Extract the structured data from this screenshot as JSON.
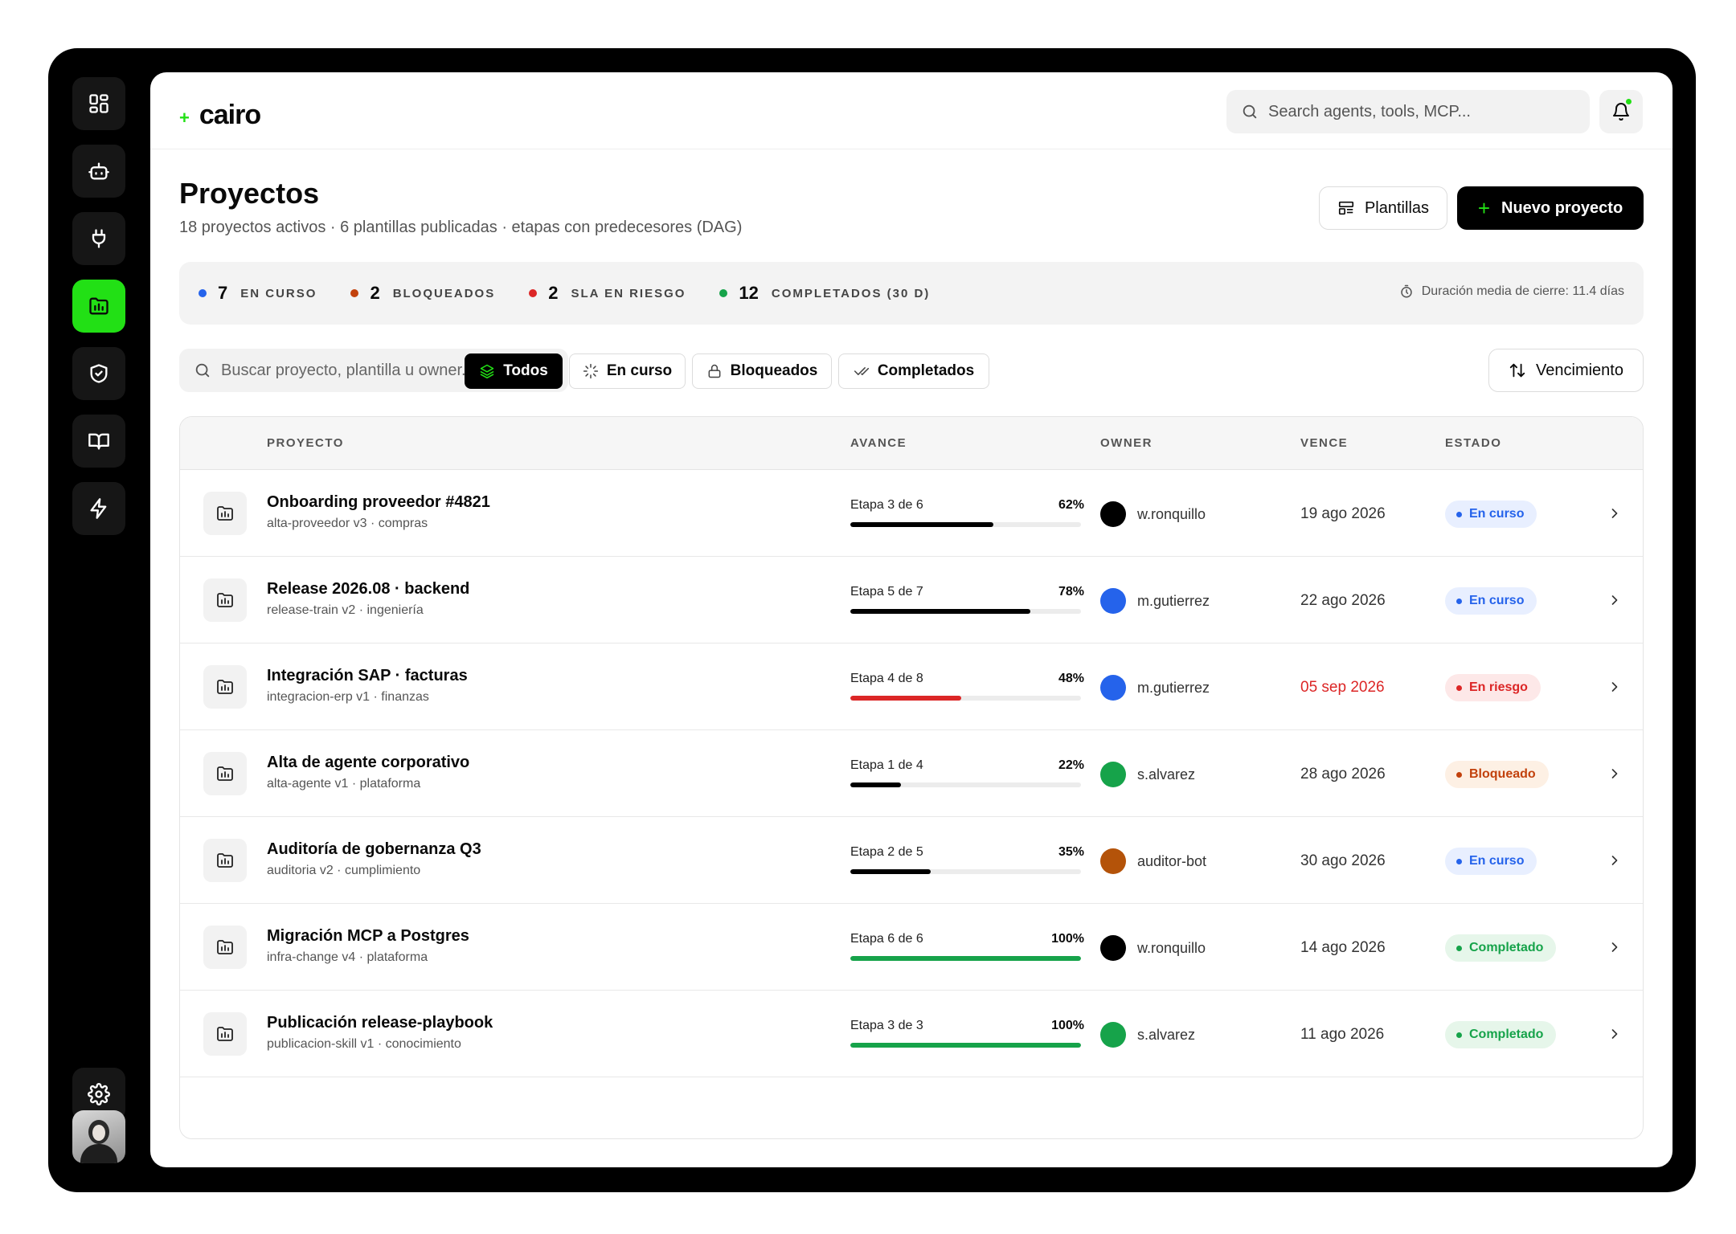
{
  "brand": {
    "name": "cairo",
    "mark": "+"
  },
  "top_search": {
    "placeholder": "Search agents, tools, MCP..."
  },
  "nav": [
    {
      "icon": "dashboard-icon",
      "active": false
    },
    {
      "icon": "bot-icon",
      "active": false
    },
    {
      "icon": "plug-icon",
      "active": false
    },
    {
      "icon": "projects-folder-icon",
      "active": true
    },
    {
      "icon": "shield-check-icon",
      "active": false
    },
    {
      "icon": "book-icon",
      "active": false
    },
    {
      "icon": "lightning-icon",
      "active": false
    }
  ],
  "header": {
    "title": "Proyectos",
    "subtitle": "18 proyectos activos · 6 plantillas publicadas · etapas con predecesores (DAG)",
    "templates_label": "Plantillas",
    "new_label": "Nuevo proyecto"
  },
  "stats": [
    {
      "value": "7",
      "label": "EN CURSO",
      "color": "#2563eb"
    },
    {
      "value": "2",
      "label": "BLOQUEADOS",
      "color": "#c2410c"
    },
    {
      "value": "2",
      "label": "SLA EN RIESGO",
      "color": "#dc2626"
    },
    {
      "value": "12",
      "label": "COMPLETADOS (30 D)",
      "color": "#16a34a"
    }
  ],
  "stats_note": "Duración media de cierre: 11.4 días",
  "filters": {
    "search_placeholder": "Buscar proyecto, plantilla u owner...",
    "chips": [
      "Todos",
      "En curso",
      "Bloqueados",
      "Completados"
    ],
    "active_chip": "Todos",
    "sort_label": "Vencimiento"
  },
  "columns": [
    "PROYECTO",
    "AVANCE",
    "OWNER",
    "VENCE",
    "ESTADO"
  ],
  "projects": [
    {
      "name": "Onboarding proveedor #4821",
      "meta": "alta-proveedor v3 · compras",
      "stage": "Etapa 3 de 6",
      "progress": 62,
      "progress_label": "62%",
      "bar_color": "#000000",
      "owner": "w.ronquillo",
      "owner_color": "#000000",
      "due": "19 ago 2026",
      "due_color": "#333333",
      "status": "En curso",
      "status_color": "#2563eb",
      "status_bg": "#e8efff"
    },
    {
      "name": "Release 2026.08 · backend",
      "meta": "release-train v2 · ingeniería",
      "stage": "Etapa 5 de 7",
      "progress": 78,
      "progress_label": "78%",
      "bar_color": "#000000",
      "owner": "m.gutierrez",
      "owner_color": "#2563eb",
      "due": "22 ago 2026",
      "due_color": "#333333",
      "status": "En curso",
      "status_color": "#2563eb",
      "status_bg": "#e8efff"
    },
    {
      "name": "Integración SAP · facturas",
      "meta": "integracion-erp v1 · finanzas",
      "stage": "Etapa 4 de 8",
      "progress": 48,
      "progress_label": "48%",
      "bar_color": "#dc2626",
      "owner": "m.gutierrez",
      "owner_color": "#2563eb",
      "due": "05 sep 2026",
      "due_color": "#dc2626",
      "status": "En riesgo",
      "status_color": "#dc2626",
      "status_bg": "#fde8e8"
    },
    {
      "name": "Alta de agente corporativo",
      "meta": "alta-agente v1 · plataforma",
      "stage": "Etapa 1 de 4",
      "progress": 22,
      "progress_label": "22%",
      "bar_color": "#000000",
      "owner": "s.alvarez",
      "owner_color": "#16a34a",
      "due": "28 ago 2026",
      "due_color": "#333333",
      "status": "Bloqueado",
      "status_color": "#c2410c",
      "status_bg": "#fdf0e4"
    },
    {
      "name": "Auditoría de gobernanza Q3",
      "meta": "auditoria v2 · cumplimiento",
      "stage": "Etapa 2 de 5",
      "progress": 35,
      "progress_label": "35%",
      "bar_color": "#000000",
      "owner": "auditor-bot",
      "owner_color": "#b45309",
      "due": "30 ago 2026",
      "due_color": "#333333",
      "status": "En curso",
      "status_color": "#2563eb",
      "status_bg": "#e8efff"
    },
    {
      "name": "Migración MCP a Postgres",
      "meta": "infra-change v4 · plataforma",
      "stage": "Etapa 6 de 6",
      "progress": 100,
      "progress_label": "100%",
      "bar_color": "#16a34a",
      "owner": "w.ronquillo",
      "owner_color": "#000000",
      "due": "14 ago 2026",
      "due_color": "#333333",
      "status": "Completado",
      "status_color": "#16a34a",
      "status_bg": "#e6f6ea"
    },
    {
      "name": "Publicación release-playbook",
      "meta": "publicacion-skill v1 · conocimiento",
      "stage": "Etapa 3 de 3",
      "progress": 100,
      "progress_label": "100%",
      "bar_color": "#16a34a",
      "owner": "s.alvarez",
      "owner_color": "#16a34a",
      "due": "11 ago 2026",
      "due_color": "#333333",
      "status": "Completado",
      "status_color": "#16a34a",
      "status_bg": "#e6f6ea"
    }
  ]
}
